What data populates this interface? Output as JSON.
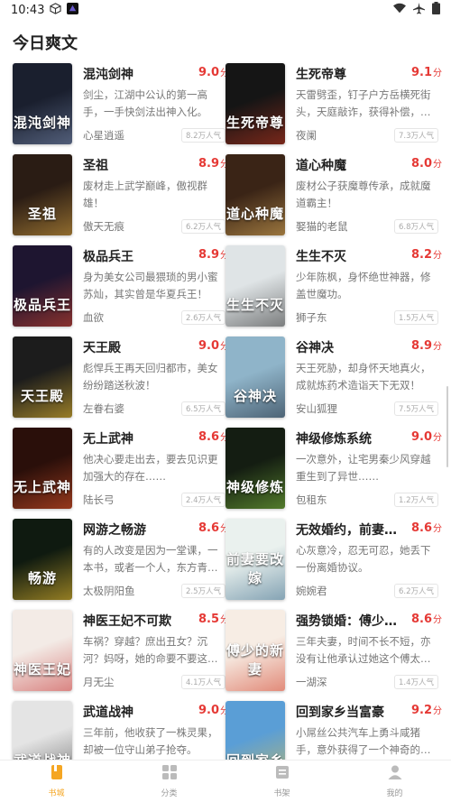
{
  "status": {
    "time": "10:43"
  },
  "section_title": "今日爽文",
  "books": [
    {
      "title": "混沌剑神",
      "score": "9.0",
      "unit": "分",
      "desc": "剑尘，江湖中公认的第一高手，一手快剑法出神入化。",
      "author": "心星逍遥",
      "popularity": "8.2万人气",
      "cover_text": "混沌剑神",
      "cover_bg": "#1a1f2e",
      "cover_accent": "#7a8cb0"
    },
    {
      "title": "生死帝尊",
      "score": "9.1",
      "unit": "分",
      "desc": "天雷劈歪，钉子户方岳横死街头，天庭敲诈，获得补偿，…",
      "author": "夜阑",
      "popularity": "7.3万人气",
      "cover_text": "生死帝尊",
      "cover_bg": "#151515",
      "cover_accent": "#c0341d"
    },
    {
      "title": "圣祖",
      "score": "8.9",
      "unit": "分",
      "desc": "废材走上武学巅峰，傲视群雄！",
      "author": "傲天无痕",
      "popularity": "6.2万人气",
      "cover_text": "圣祖",
      "cover_bg": "#2a1c14",
      "cover_accent": "#d9a441"
    },
    {
      "title": "道心种魔",
      "score": "8.0",
      "unit": "分",
      "desc": "废材公子获魔尊传承，成就魔道霸主！",
      "author": "娶猫的老鼠",
      "popularity": "6.8万人气",
      "cover_text": "道心种魔",
      "cover_bg": "#3a2416",
      "cover_accent": "#e0b05a"
    },
    {
      "title": "极品兵王",
      "score": "8.9",
      "unit": "分",
      "desc": "身为美女公司最猥琐的男小蜜苏灿，其实曾是华夏兵王！",
      "author": "血欲",
      "popularity": "2.6万人气",
      "cover_text": "极品兵王",
      "cover_bg": "#1e1530",
      "cover_accent": "#d6452c"
    },
    {
      "title": "生生不灭",
      "score": "8.2",
      "unit": "分",
      "desc": "少年陈枫，身怀绝世神器，修盖世魔功。",
      "author": "狮子东",
      "popularity": "1.5万人气",
      "cover_text": "生生不灭",
      "cover_bg": "#dfe4e6",
      "cover_accent": "#333333"
    },
    {
      "title": "天王殿",
      "score": "9.0",
      "unit": "分",
      "desc": "彪悍兵王再天回归都市，美女纷纷踏送秋波！",
      "author": "左眷右婆",
      "popularity": "6.5万人气",
      "cover_text": "天王殿",
      "cover_bg": "#1c1c1c",
      "cover_accent": "#f2c230"
    },
    {
      "title": "谷神决",
      "score": "8.9",
      "unit": "分",
      "desc": "天王死胁，却身怀天地真火，成就炼药术造诣天下无双！",
      "author": "安山狐狸",
      "popularity": "7.5万人气",
      "cover_text": "谷神决",
      "cover_bg": "#8fb4c9",
      "cover_accent": "#1e2a3a"
    },
    {
      "title": "无上武神",
      "score": "8.6",
      "unit": "分",
      "desc": "他决心要走出去，要去见识更加强大的存在……",
      "author": "陆长弓",
      "popularity": "2.4万人气",
      "cover_text": "无上武神",
      "cover_bg": "#2a0f0a",
      "cover_accent": "#e4562a"
    },
    {
      "title": "神级修炼系统",
      "score": "9.0",
      "unit": "分",
      "desc": "一次意外，让宅男秦少风穿越重生到了异世……",
      "author": "包租东",
      "popularity": "1.2万人气",
      "cover_text": "神级修炼",
      "cover_bg": "#141d12",
      "cover_accent": "#7fbf3d"
    },
    {
      "title": "网游之畅游",
      "score": "8.6",
      "unit": "分",
      "desc": "有的人改变是因为一堂课，一本书，或者一个人，东方青…",
      "author": "太极阴阳鱼",
      "popularity": "2.5万人气",
      "cover_text": "畅游",
      "cover_bg": "#0f1a10",
      "cover_accent": "#f4c531"
    },
    {
      "title": "无效婚约，前妻…",
      "score": "8.6",
      "unit": "分",
      "desc": "心灰意冷，忍无可忍，她丢下一份离婚协议。",
      "author": "婉婉君",
      "popularity": "6.2万人气",
      "cover_text": "前妻要改嫁",
      "cover_bg": "#eaf1ee",
      "cover_accent": "#3b6b8a"
    },
    {
      "title": "神医王妃不可欺",
      "score": "8.5",
      "unit": "分",
      "desc": "车祸？穿越？庶出丑女？沉河？妈呀，她的命要不要这…",
      "author": "月无尘",
      "popularity": "4.1万人气",
      "cover_text": "神医王妃",
      "cover_bg": "#f3ebe6",
      "cover_accent": "#c73a3a"
    },
    {
      "title": "强势锁婚：傅少…",
      "score": "8.6",
      "unit": "分",
      "desc": "三年夫妻，时间不长不短，亦没有让他承认过她这个傅太…",
      "author": "一湖深",
      "popularity": "1.4万人气",
      "cover_text": "傅少的新妻",
      "cover_bg": "#f7ede4",
      "cover_accent": "#d2442d"
    },
    {
      "title": "武道战神",
      "score": "9.0",
      "unit": "分",
      "desc": "三年前，他收获了一株灵果，却被一位守山弟子抢夺。",
      "author": "",
      "popularity": "",
      "cover_text": "武道战神",
      "cover_bg": "#e4e4e4",
      "cover_accent": "#333333"
    },
    {
      "title": "回到家乡当富豪",
      "score": "9.2",
      "unit": "分",
      "desc": "小屌丝公共汽车上勇斗咸猪手，意外获得了一个神奇的…",
      "author": "",
      "popularity": "",
      "cover_text": "回到家乡",
      "cover_bg": "#5a9ed6",
      "cover_accent": "#f4c531"
    }
  ],
  "tabs": [
    {
      "label": "书城",
      "icon": "bookstore-icon",
      "active": true
    },
    {
      "label": "分类",
      "icon": "category-icon",
      "active": false
    },
    {
      "label": "书架",
      "icon": "bookshelf-icon",
      "active": false
    },
    {
      "label": "我的",
      "icon": "profile-icon",
      "active": false
    }
  ],
  "colors": {
    "accent": "#f5a623",
    "score": "#e53935"
  }
}
